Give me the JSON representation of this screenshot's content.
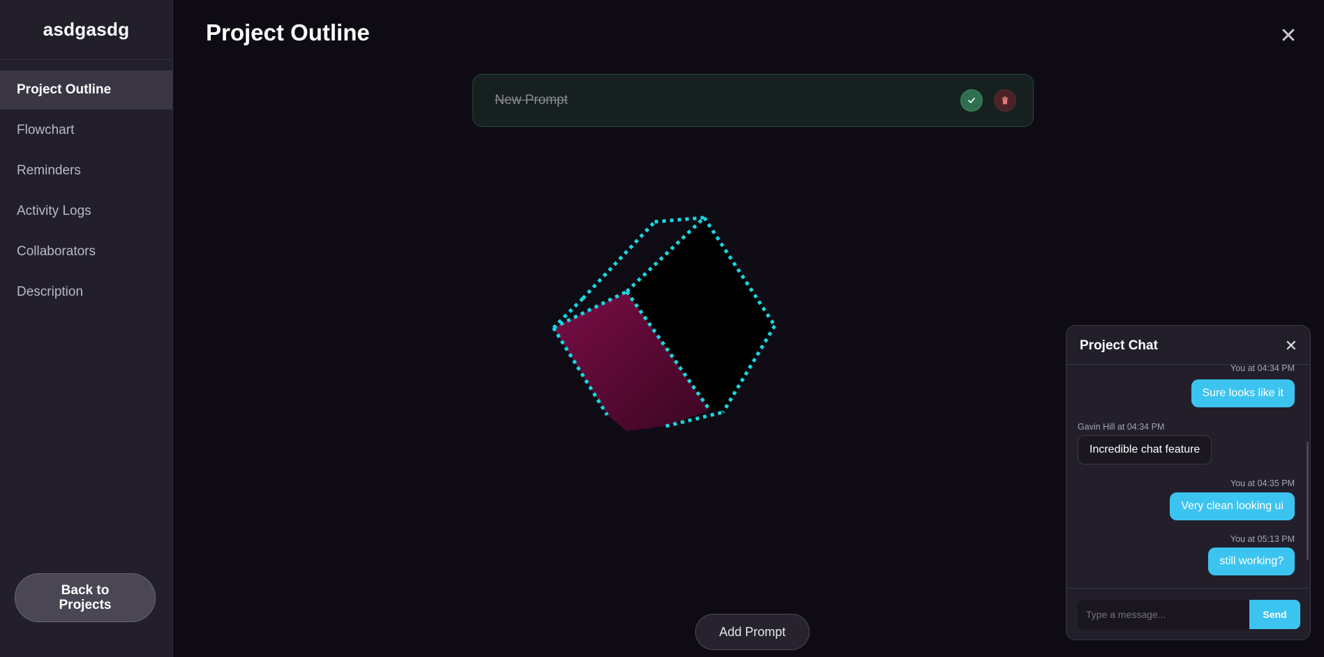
{
  "sidebar": {
    "brand": "asdgasdg",
    "items": [
      {
        "label": "Project Outline",
        "active": true
      },
      {
        "label": "Flowchart"
      },
      {
        "label": "Reminders"
      },
      {
        "label": "Activity Logs"
      },
      {
        "label": "Collaborators"
      },
      {
        "label": "Description"
      }
    ],
    "back_label": "Back to Projects"
  },
  "main": {
    "title": "Project Outline",
    "prompt": {
      "text": "New Prompt",
      "completed": true
    },
    "add_prompt_label": "Add Prompt"
  },
  "chat": {
    "title": "Project Chat",
    "messages": [
      {
        "meta": "You at 04:34 PM",
        "text": "Sure looks like it",
        "mine": true
      },
      {
        "meta": "Gavin Hill at 04:34 PM",
        "text": "Incredible chat feature",
        "mine": false
      },
      {
        "meta": "You at 04:35 PM",
        "text": "Very clean looking ui",
        "mine": true
      },
      {
        "meta": "You at 05:13 PM",
        "text": "still working?",
        "mine": true
      }
    ],
    "input_placeholder": "Type a message...",
    "send_label": "Send"
  },
  "colors": {
    "accent": "#3cc4f0",
    "cube_edge": "#1ad7e0",
    "cube_face": "#6a0b3d",
    "check_green": "#2f6f4f",
    "trash_red": "#e07a7a"
  }
}
